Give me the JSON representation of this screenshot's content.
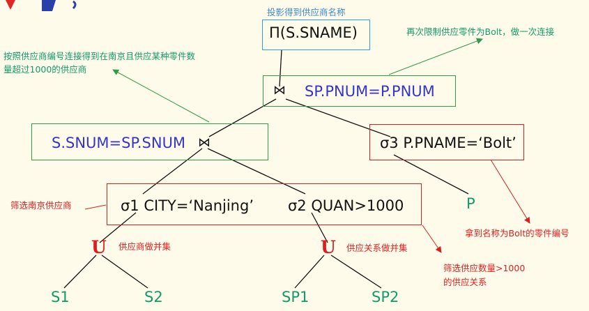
{
  "colors": {
    "background": "#fffbea",
    "predicate_blue": "#3535c8",
    "leaf_green": "#139a6a",
    "note_red": "#e02020",
    "note_green": "#139a6a",
    "box_green": "#2e9c4a",
    "box_red": "#d42020",
    "box_cyan": "#2aa0d8"
  },
  "projection": {
    "caption": "投影得到供应商名称",
    "expr": "Π(S.SNAME)"
  },
  "top_join": {
    "caption": "再次限制供应零件为Bolt，做一次连接",
    "symbol": "⋈",
    "predicate": "SP.PNUM=P.PNUM"
  },
  "left_join": {
    "caption_line1": "按照供应商编号连接得到在南京且供应某种零件数",
    "caption_line2": "量超过1000的供应商",
    "predicate": "S.SNUM=SP.SNUM",
    "symbol": "⋈"
  },
  "sigma3": {
    "expr": "σ3 P.PNAME=‘Bolt’",
    "caption": "拿到名称为Bolt的零件编号"
  },
  "selects": {
    "caption_left": "筛选南京供应商",
    "sigma1": "σ1 CITY=‘Nanjing’",
    "sigma2": "σ2 QUAN>1000",
    "caption_right_line1": "筛选供应数量>1000",
    "caption_right_line2": "的供应关系"
  },
  "unions": {
    "symbol": "U",
    "left_caption": "供应商做并集",
    "right_caption": "供应关系做并集"
  },
  "leaves": {
    "s1": "S1",
    "s2": "S2",
    "sp1": "SP1",
    "sp2": "SP2",
    "p": "P"
  }
}
